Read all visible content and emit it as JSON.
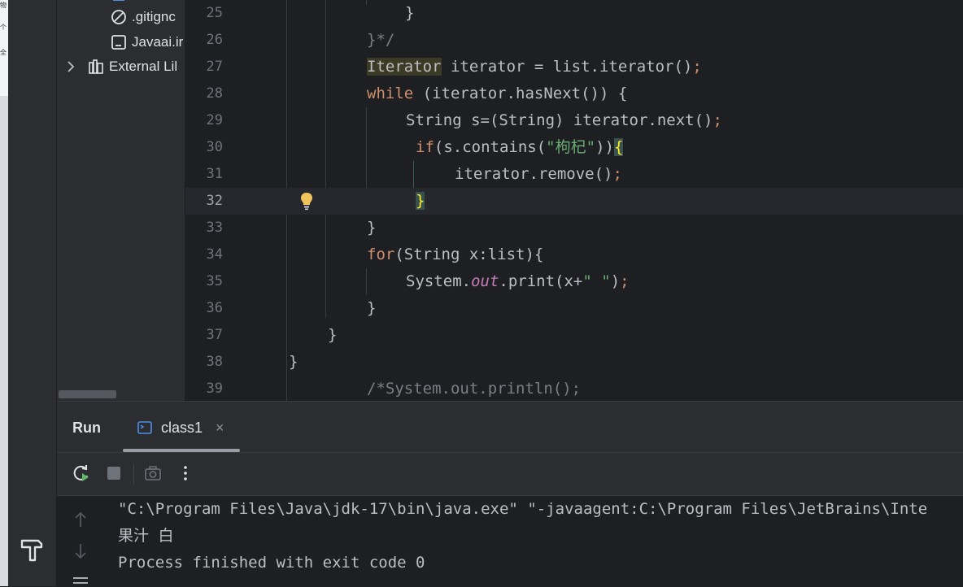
{
  "colors": {
    "keyword": "#cf8e6d",
    "string": "#6aab73",
    "comment": "#7a7e85",
    "static_field": "#c77dbb",
    "default_text": "#bcbec4",
    "brace_match": "#ffef28"
  },
  "left_strip": {
    "glyphs": [
      "物",
      "个",
      "全"
    ]
  },
  "project_tree": {
    "items": [
      {
        "label": ".gitignore",
        "shown_text": ".gitignc",
        "icon": "ignore-file-icon"
      },
      {
        "label": "Javaai.iml",
        "shown_text": "Javaai.ir",
        "icon": "module-file-icon"
      },
      {
        "label": "External Libraries",
        "shown_text": "External Lil",
        "icon": "library-icon"
      }
    ]
  },
  "editor": {
    "current_line": 32,
    "lines": [
      {
        "num": "25",
        "text": "}"
      },
      {
        "num": "26",
        "text": "}*/"
      },
      {
        "num": "27",
        "type": "Iterator",
        "text": " iterator = list.iterator()",
        "semi": ";"
      },
      {
        "num": "28",
        "kw": "while",
        "text": " (iterator.hasNext()) {"
      },
      {
        "num": "29",
        "text": "String s=(String) iterator.next()",
        "semi": ";"
      },
      {
        "num": "30",
        "kw": "if",
        "pre": "(s.contains(",
        "str": "\"枸杞\"",
        "post": "))",
        "brace": "{"
      },
      {
        "num": "31",
        "text": "iterator.remove()",
        "semi": ";"
      },
      {
        "num": "32",
        "brace": "}"
      },
      {
        "num": "33",
        "text": "}"
      },
      {
        "num": "34",
        "kw": "for",
        "text": "(String x:list){"
      },
      {
        "num": "35",
        "pre": "System.",
        "field": "out",
        "post": ".print(x+",
        "str": "\" \"",
        "end": ")",
        "semi": ";"
      },
      {
        "num": "36",
        "text": "}"
      },
      {
        "num": "37",
        "text": "}"
      },
      {
        "num": "38",
        "text": "}"
      },
      {
        "num": "39",
        "comment": "/*System.out.println();"
      }
    ]
  },
  "run_panel": {
    "title": "Run",
    "tab_label": "class1",
    "tab_close": "×",
    "console_lines": [
      "\"C:\\Program Files\\Java\\jdk-17\\bin\\java.exe\" \"-javaagent:C:\\Program Files\\JetBrains\\Inte",
      "果汁 白",
      "Process finished with exit code 0"
    ]
  }
}
